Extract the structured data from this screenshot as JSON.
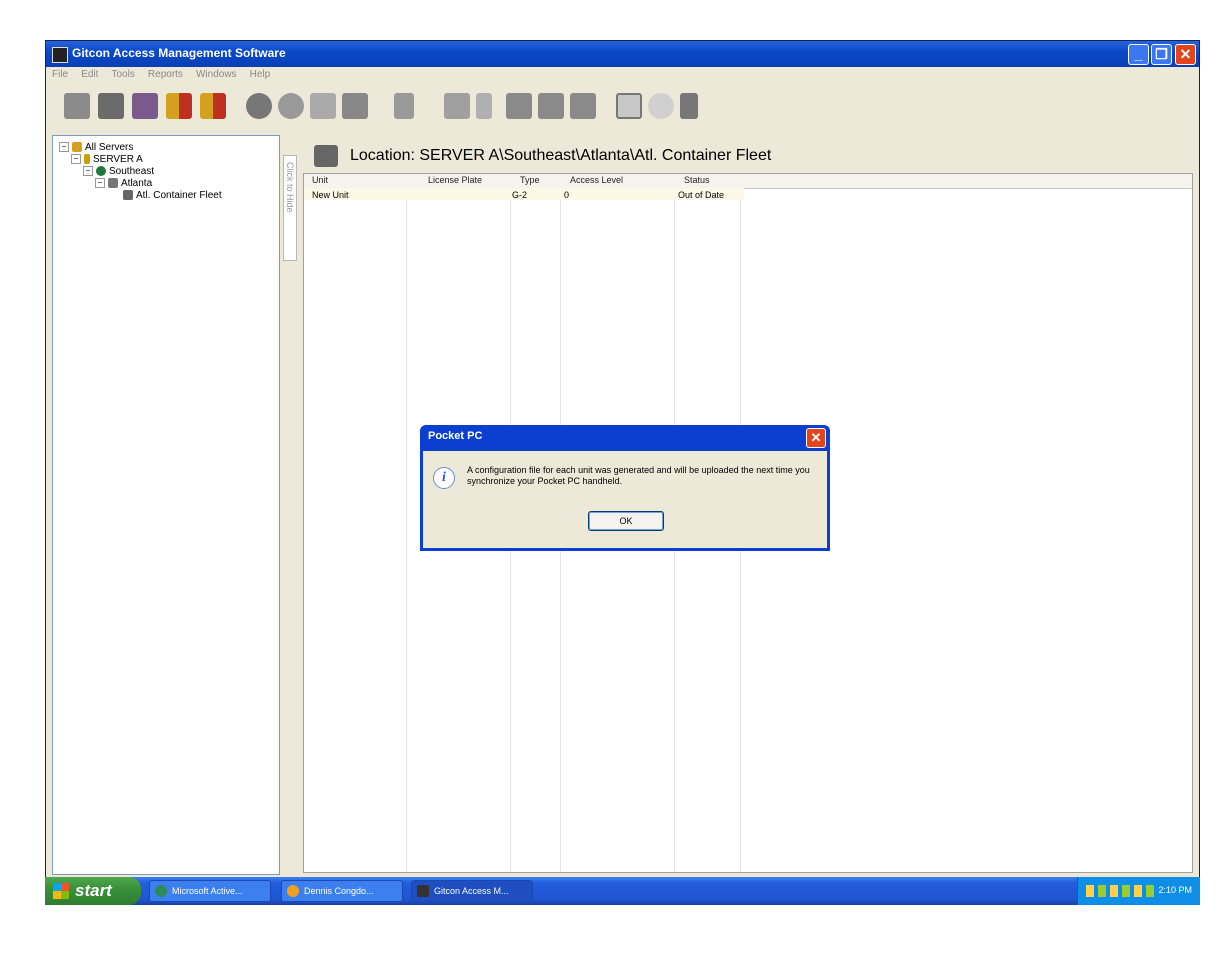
{
  "window": {
    "title": "Gitcon Access Management Software"
  },
  "menu": [
    "File",
    "Edit",
    "Tools",
    "Reports",
    "Windows",
    "Help"
  ],
  "toolbar": {
    "icons": [
      "unit-icon",
      "unit-edit-icon",
      "unit-add-icon",
      "report-icon",
      "report-alt-icon",
      "globe-icon",
      "box-icon",
      "card-icon",
      "panel-icon",
      "server-icon",
      "group-icon",
      "lock-icon",
      "sync-icon",
      "sync-all-icon",
      "upload-icon",
      "window-icon",
      "settings-icon",
      "trash-icon"
    ]
  },
  "tree": {
    "items": [
      {
        "label": "All Servers",
        "level": 0
      },
      {
        "label": "SERVER A",
        "level": 1
      },
      {
        "label": "Southeast",
        "level": 2
      },
      {
        "label": "Atlanta",
        "level": 3
      },
      {
        "label": "Atl. Container Fleet",
        "level": 4
      }
    ]
  },
  "autohide_label": "Click to Hide",
  "location": {
    "label": "Location: SERVER A\\Southeast\\Atlanta\\Atl. Container Fleet"
  },
  "grid": {
    "columns": [
      "Unit",
      "License Plate",
      "Type",
      "Access Level",
      "Status"
    ],
    "rows": [
      {
        "unit": "New Unit",
        "license_plate": "",
        "type": "G-2",
        "access_level": "0",
        "status": "Out of Date"
      }
    ]
  },
  "dialog": {
    "title": "Pocket PC",
    "message": "A configuration file for each unit was generated and will be uploaded the next time you synchronize your Pocket PC handheld.",
    "ok_label": "OK"
  },
  "taskbar": {
    "start_label": "start",
    "tasks": [
      {
        "label": "Microsoft Active..."
      },
      {
        "label": "Dennis Congdo..."
      },
      {
        "label": "Gitcon Access M..."
      }
    ],
    "clock": "2:10 PM"
  },
  "colors": {
    "titlebar": "#0a49c8",
    "dialog_frame": "#0a3fcf",
    "close": "#e0451d",
    "start": "#3a913a"
  }
}
